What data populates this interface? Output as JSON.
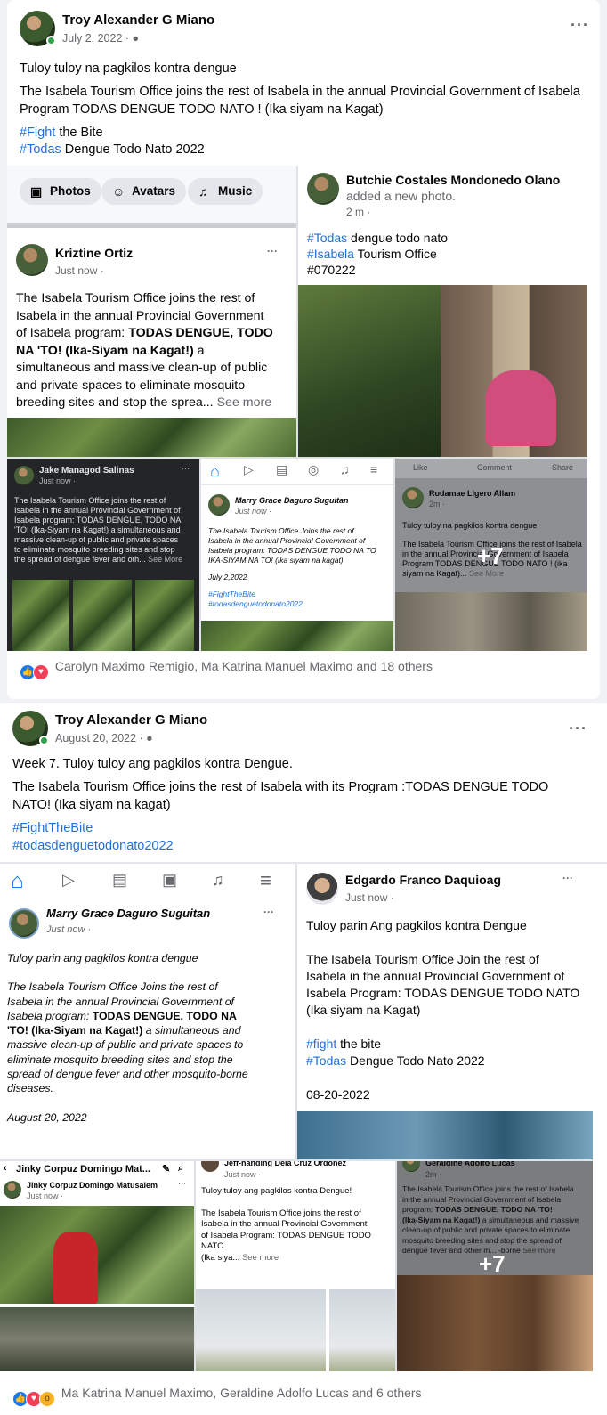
{
  "colors": {
    "link": "#216fdb",
    "like": "#1877f2",
    "love": "#f33e58",
    "muted": "#65676b",
    "online": "#31a24c"
  },
  "post1": {
    "author": "Troy Alexander G Miano",
    "date": "July 2, 2022 · ",
    "line1": "Tuloy tuloy na pagkilos kontra dengue",
    "line2a": "The Isabela Tourism Office joins the rest of Isabela in the annual Provincial Government of Isabela",
    "line2b": "Program TODAS DENGUE TODO NATO ! (Ika siyam na Kagat)",
    "tag1": "#Fight",
    "tag1_rest": " the Bite",
    "tag2": "#Todas",
    "tag2_rest": " Dengue Todo Nato 2022",
    "chips": [
      "Photos",
      "Avatars",
      "Music"
    ],
    "kriztine": {
      "name": "Kriztine Ortiz",
      "meta": "Just now · ",
      "t1": "The  Isabela Tourism Office joins the rest of",
      "t2": "Isabela in the annual Provincial Government",
      "t3a": "of Isabela program: ",
      "t3b": "TODAS DENGUE, TODO",
      "t4a": "NA 'TO! (Ika-Siyam na Kagat!)",
      "t4b": " a",
      "t5": "simultaneous and massive clean-up of public",
      "t6": "and private spaces to eliminate mosquito",
      "t7": "breeding sites and stop the sprea... ",
      "seemore": "See more"
    },
    "butchie": {
      "name": "Butchie Costales Mondonedo Olano",
      "action": "added a new photo.",
      "meta": "2 m · ",
      "tag1": "#Todas",
      "tag1_rest": " dengue todo nato",
      "tag2": "#Isabela",
      "tag2_rest": " Tourism Office",
      "code": "#070222"
    },
    "jake": {
      "name": "Jake Managod Salinas",
      "meta": "Just now · ",
      "l1": "The  Isabela Tourism Office joins the rest of",
      "l2": "Isabela in the annual Provincial Government of",
      "l3": "Isabela program: TODAS DENGUE, TODO NA",
      "l4": "'TO! (Ika-Siyam na Kagat!) a simultaneous and",
      "l5": "massive clean-up of public and private spaces",
      "l6": "to eliminate mosquito breeding sites and stop",
      "l7": "the spread of dengue fever and oth... ",
      "seemore": "See More"
    },
    "marry": {
      "name": "Marry Grace Daguro Suguitan",
      "meta": "Just now · ",
      "l1": "The Isabela Tourism Office Joins the rest of",
      "l2": "Isabela in the annual Provincial Government of",
      "l3": "Isabela program: TODAS DENGUE TODO NA TO",
      "l4": "IKA-SIYAM NA TO! (Ika siyam na kagat)",
      "date": "July 2,2022",
      "tag1": "#FightTheBite",
      "tag2": "#todasdenguetodonato2022"
    },
    "rodamae": {
      "name": "Rodamae Ligero Allam",
      "meta": "2m · ",
      "like": "Like",
      "comment": "Comment",
      "share": "Share",
      "l0": "Tuloy tuloy na pagkilos kontra dengue",
      "l1": "The Isabela Tourism Office joins the rest of Isabela",
      "l2": "in the annual Provincial Government of Isabela",
      "l3": "Program TODAS DENGUE TODO NATO ! (ika",
      "l4": "siyam na Kagat)... ",
      "seemore": "See More"
    },
    "plus": "+7",
    "reactions": "Carolyn Maximo Remigio, Ma Katrina Manuel Maximo and 18 others"
  },
  "post2": {
    "author": "Troy Alexander G Miano",
    "date": "August 20, 2022 · ",
    "line1": "Week 7. Tuloy tuloy ang pagkilos kontra Dengue.",
    "line2a": "The Isabela Tourism Office joins the rest of Isabela with its  Program :TODAS DENGUE TODO",
    "line2b": "NATO! (Ika siyam na kagat)",
    "tag1": "#FightTheBite",
    "tag2": "#todasdenguetodonato2022",
    "marry": {
      "name": "Marry Grace Daguro Suguitan",
      "meta": "Just now · ",
      "l0": "Tuloy parin ang pagkilos kontra dengue",
      "l1": "The  Isabela Tourism Office Joins the rest of",
      "l2": "Isabela in the annual Provincial Government of",
      "l3a": "Isabela program: ",
      "l3b": "TODAS DENGUE, TODO NA",
      "l4a": "'TO! (Ika-Siyam na Kagat!)",
      "l4b": " a simultaneous and",
      "l5": "massive clean-up of public and private spaces to",
      "l6": "eliminate mosquito breeding sites and stop the",
      "l7": "spread of dengue fever and other mosquito-borne",
      "l8": "diseases.",
      "date": "August 20, 2022"
    },
    "edgardo": {
      "name": "Edgardo Franco Daquioag",
      "meta": "Just now · ",
      "l0": "Tuloy parin Ang pagkilos kontra Dengue",
      "l1": "The Isabela Tourism Office Join the rest of",
      "l2": "Isabela in the annual Provincial Government of",
      "l3": "Isabela Program: TODAS DENGUE TODO NATO",
      "l4": "(Ika siyam na Kagat)",
      "tag1": "#fight",
      "tag1_rest": " the bite",
      "tag2": "#Todas",
      "tag2_rest": " Dengue Todo Nato 2022",
      "date": "08-20-2022"
    },
    "jinky": {
      "title": "Jinky Corpuz Domingo Mat...",
      "name": "Jinky Corpuz Domingo Matusalem",
      "meta": "Just now · "
    },
    "jeff": {
      "name": "Jeff-handing Dela Cruz Ordonez",
      "meta": "Just now · ",
      "l0": "Tuloy tuloy ang pagkilos kontra Dengue!",
      "l1": "The Isabela Tourism Office joins the rest of",
      "l2": "Isabela in the annual Provincial Government",
      "l3": "of Isabela Program: TODAS DENGUE TODO",
      "l4": "NATO",
      "l5": "(Ika siya... ",
      "seemore": "See more"
    },
    "geraldine": {
      "name": "Geraldine Adolfo Lucas",
      "meta": "2m · ",
      "l1": "The  Isabela Tourism Office joins the rest of Isabela",
      "l2": "in the annual Provincial Government of Isabela",
      "l3a": "program: ",
      "l3b": "TODAS DENGUE, TODO NA 'TO!",
      "l4a": "(Ika-Siyam na Kagat!)",
      "l4b": " a simultaneous and massive",
      "l5": "clean-up of public and private spaces to eliminate",
      "l6": "mosquito breeding sites and stop the spread of",
      "l7": "dengue fever and other m... -borne ",
      "seemore": "See more"
    },
    "plus": "+7",
    "reactions": "Ma Katrina Manuel Maximo, Geraldine Adolfo Lucas and 6 others"
  }
}
